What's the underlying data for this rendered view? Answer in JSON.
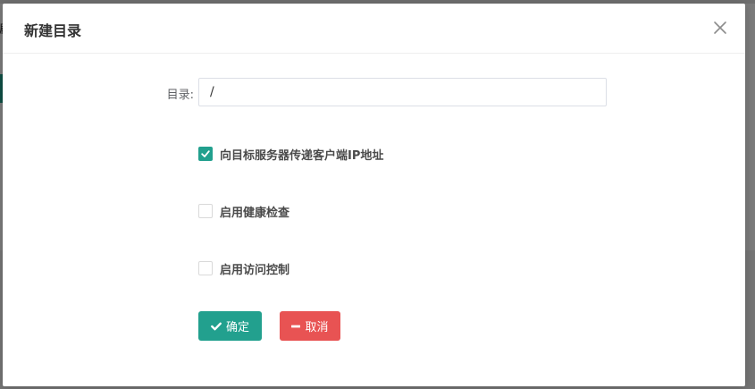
{
  "background": {
    "glyph": "编"
  },
  "dialog": {
    "title": "新建目录",
    "close_icon": "close-icon",
    "directory": {
      "label": "目录:",
      "value": "/",
      "placeholder": ""
    },
    "options": [
      {
        "label": "向目标服务器传递客户端IP地址",
        "checked": true
      },
      {
        "label": "启用健康检查",
        "checked": false
      },
      {
        "label": "启用访问控制",
        "checked": false
      }
    ],
    "buttons": {
      "confirm": {
        "label": "确定",
        "icon": "check-icon"
      },
      "cancel": {
        "label": "取消",
        "icon": "minus-icon"
      }
    },
    "colors": {
      "primary": "#22a08e",
      "danger": "#e85353"
    }
  }
}
